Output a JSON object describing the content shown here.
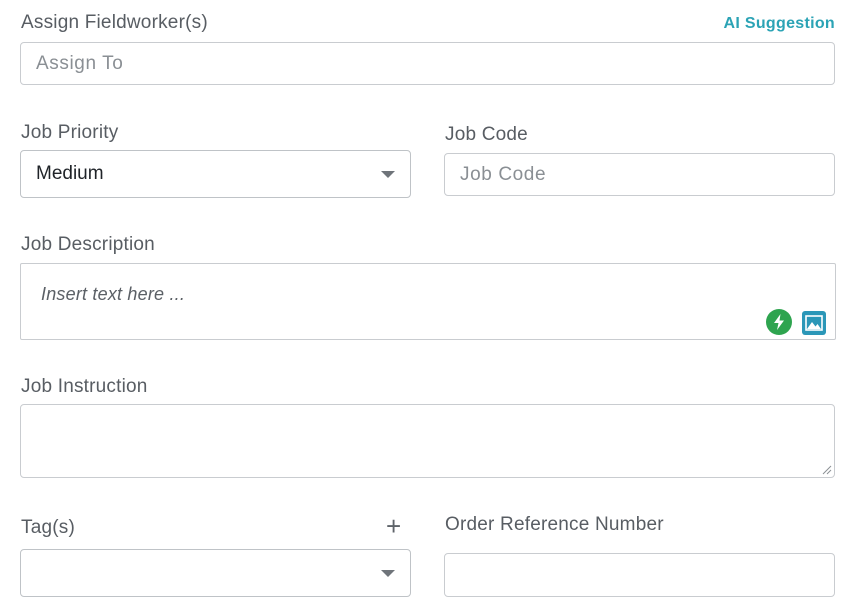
{
  "assign": {
    "label": "Assign Fieldworker(s)",
    "ai_link": "AI Suggestion",
    "placeholder": "Assign To",
    "value": ""
  },
  "priority": {
    "label": "Job Priority",
    "selected": "Medium",
    "options": [
      "Medium"
    ]
  },
  "job_code": {
    "label": "Job Code",
    "placeholder": "Job Code",
    "value": ""
  },
  "description": {
    "label": "Job Description",
    "placeholder": "Insert text here ...",
    "icons": [
      "lightning-bolt-icon",
      "image-icon"
    ],
    "colors": {
      "bolt": "#2ea44f",
      "image": "#2b97b8"
    }
  },
  "instruction": {
    "label": "Job Instruction",
    "value": ""
  },
  "tags": {
    "label": "Tag(s)",
    "add_icon": "plus-icon",
    "selected": ""
  },
  "order_ref": {
    "label": "Order Reference Number",
    "value": ""
  },
  "theme": {
    "accent": "#2ba3b5",
    "border": "#c9ccd0",
    "label_color": "#585d63"
  }
}
